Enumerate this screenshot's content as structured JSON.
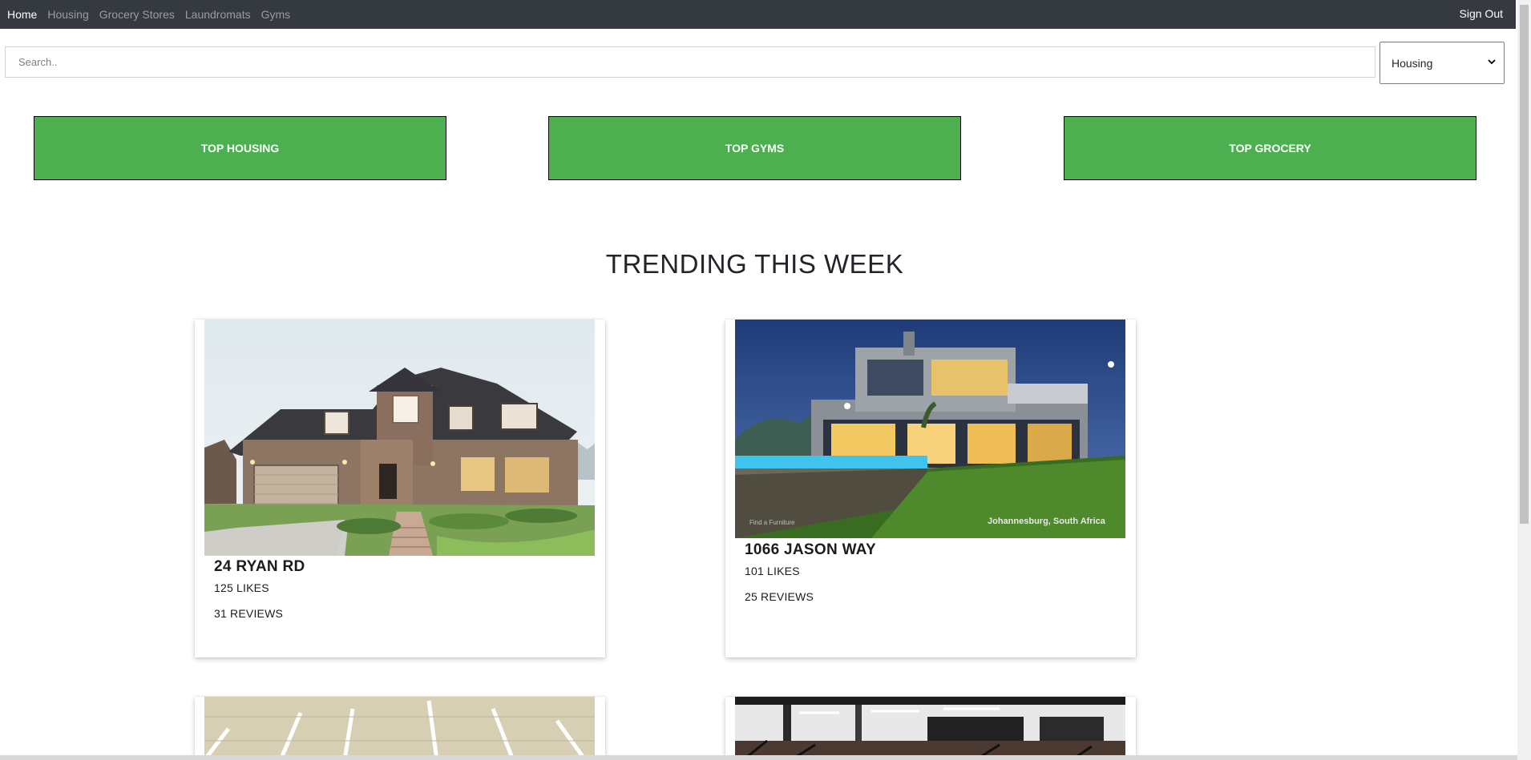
{
  "nav": {
    "links": [
      {
        "label": "Home",
        "active": true
      },
      {
        "label": "Housing",
        "active": false
      },
      {
        "label": "Grocery Stores",
        "active": false
      },
      {
        "label": "Laundromats",
        "active": false
      },
      {
        "label": "Gyms",
        "active": false
      }
    ],
    "sign_out": "Sign Out"
  },
  "search": {
    "placeholder": "Search..",
    "value": "",
    "category": "Housing"
  },
  "top_buttons": [
    "TOP HOUSING",
    "TOP GYMS",
    "TOP GROCERY"
  ],
  "trending": {
    "title": "TRENDING THIS WEEK",
    "cards": [
      {
        "name": "24 RYAN RD",
        "likes": "125 LIKES",
        "reviews": "31 REVIEWS"
      },
      {
        "name": "1066 JASON WAY",
        "likes": "101 LIKES",
        "reviews": "25 REVIEWS",
        "image_caption": "Johannesburg, South Africa",
        "image_watermark": "Find a Furniture"
      }
    ]
  },
  "colors": {
    "navbar": "#343a40",
    "accent_green": "#4caf50"
  }
}
